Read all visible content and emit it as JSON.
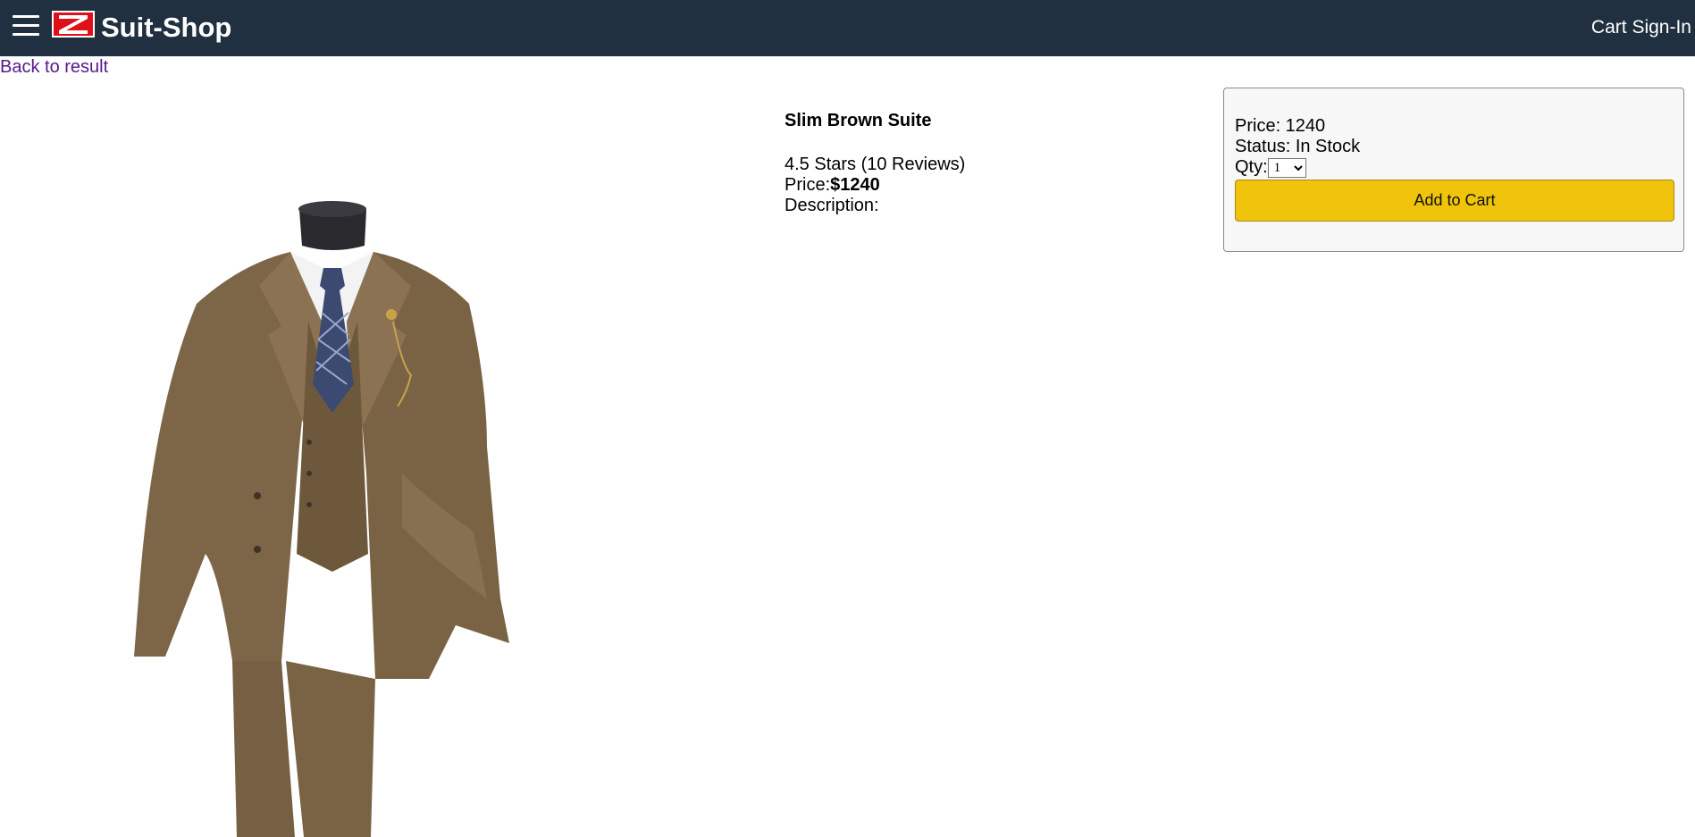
{
  "header": {
    "brand": "Suit-Shop",
    "cart_link": "Cart",
    "signin_link": "Sign-In"
  },
  "nav": {
    "back_link": "Back to result"
  },
  "product": {
    "name": "Slim Brown Suite",
    "rating_text": "4.5 Stars (10 Reviews)",
    "price_label": "Price:",
    "price_value": "$1240",
    "description_label": "Description:"
  },
  "purchase": {
    "price_text": "Price: 1240",
    "status_text": "Status: In Stock",
    "qty_label": "Qty:",
    "qty_value": "1",
    "add_button": "Add to Cart"
  },
  "colors": {
    "header_bg": "#203040",
    "button_bg": "#f0c40c",
    "link": "#551a8b"
  },
  "icons": {
    "menu": "hamburger-icon",
    "logo": "z-logo-icon"
  }
}
